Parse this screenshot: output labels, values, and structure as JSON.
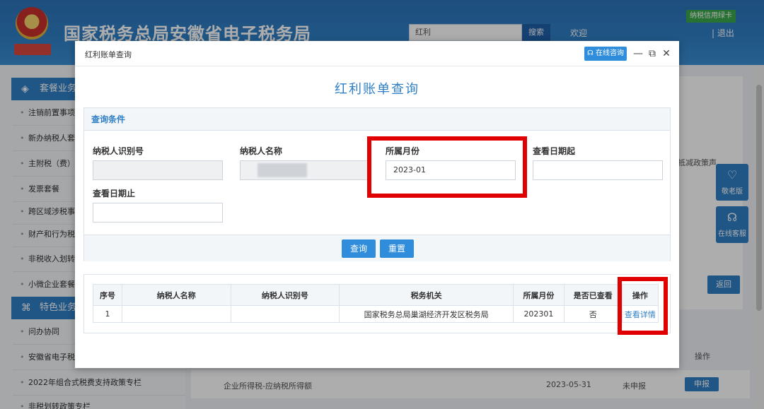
{
  "header": {
    "brand_title": "国家税务总局安徽省电子税务局",
    "search_value": "红利",
    "search_button": "搜索",
    "welcome": "欢迎",
    "credit_card": "纳税信用绿卡",
    "logout": "| 退出"
  },
  "sidebar": {
    "section_1": "套餐业务",
    "items_1": [
      "注销前置事项",
      "新办纳税人套",
      "主附税（费）",
      "发票套餐",
      "跨区域涉税事",
      "财产和行为税",
      "非税收入划转",
      "小微企业套餐"
    ],
    "section_2": "特色业务",
    "items_2": [
      "问办协同",
      "安徽省电子税",
      "2022年组合式税费支持政策专栏",
      "非税划转政策专栏"
    ]
  },
  "background": {
    "policy_snippet": "抵减政策声",
    "elder_label": "敬老版",
    "service_label": "在线客服",
    "return_label": "返回",
    "op_header": "操作",
    "row_item": "企业所得税-应纳税所得额",
    "row_date": "2023-05-31",
    "row_status": "未申报",
    "declare_label": "申报"
  },
  "modal": {
    "bar_title": "红利账单查询",
    "online_consult": "在线咨询",
    "title": "红利账单查询",
    "query_section": "查询条件",
    "fields": {
      "taxpayer_id_label": "纳税人识别号",
      "taxpayer_name_label": "纳税人名称",
      "month_label": "所属月份",
      "month_value": "2023-01",
      "view_date_from_label": "查看日期起",
      "view_date_to_label": "查看日期止"
    },
    "query_button": "查询",
    "reset_button": "重置",
    "table": {
      "headers": [
        "序号",
        "纳税人名称",
        "纳税人识别号",
        "税务机关",
        "所属月份",
        "是否已查看",
        "操作"
      ],
      "rows": [
        {
          "index": "1",
          "name": "",
          "id": "",
          "authority": "国家税务总局巢湖经济开发区税务局",
          "month": "202301",
          "viewed": "否",
          "action": "查看详情"
        }
      ]
    }
  },
  "colors": {
    "primary": "#2f7fc6",
    "button": "#2f8ddb",
    "highlight": "#e00000"
  }
}
